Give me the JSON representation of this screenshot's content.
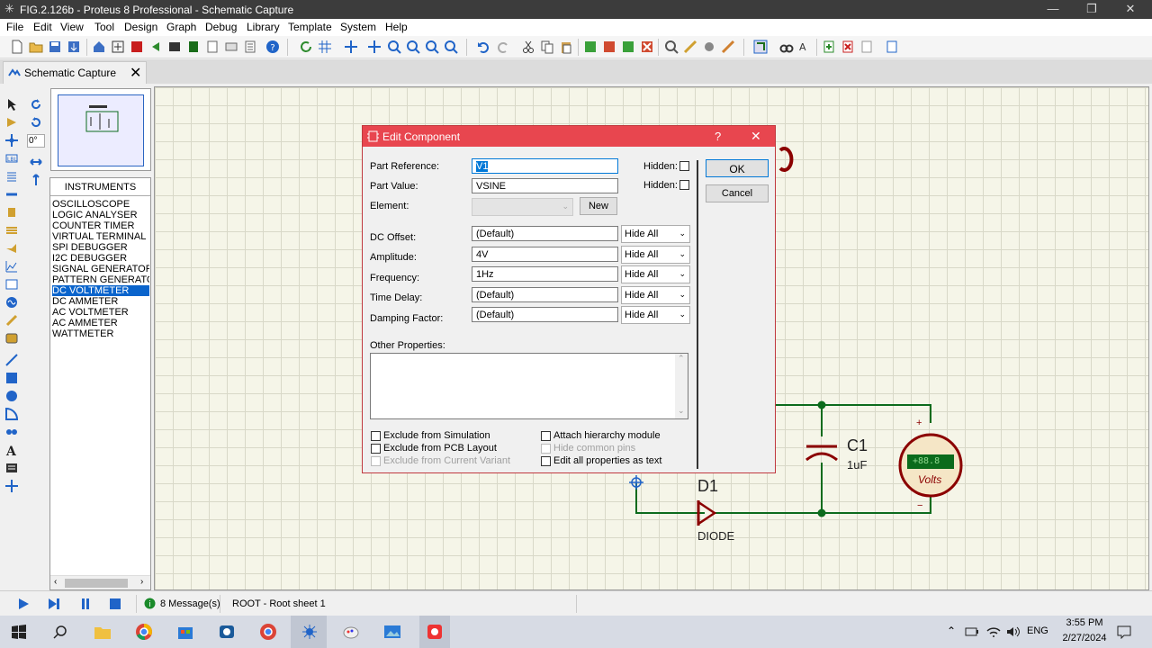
{
  "window": {
    "title": "FIG.2.126b - Proteus 8 Professional - Schematic Capture"
  },
  "menu": [
    "File",
    "Edit",
    "View",
    "Tool",
    "Design",
    "Graph",
    "Debug",
    "Library",
    "Template",
    "System",
    "Help"
  ],
  "tab": {
    "label": "Schematic Capture"
  },
  "rotation": "0°",
  "library": {
    "header": "INSTRUMENTS",
    "items": [
      "OSCILLOSCOPE",
      "LOGIC ANALYSER",
      "COUNTER TIMER",
      "VIRTUAL TERMINAL",
      "SPI DEBUGGER",
      "I2C DEBUGGER",
      "SIGNAL GENERATOR",
      "PATTERN GENERATO",
      "DC VOLTMETER",
      "DC AMMETER",
      "AC VOLTMETER",
      "AC AMMETER",
      "WATTMETER"
    ],
    "selected": "DC VOLTMETER"
  },
  "dialog": {
    "title": "Edit Component",
    "help": "?",
    "part_reference": {
      "label": "Part Reference:",
      "value": "V1"
    },
    "part_value": {
      "label": "Part Value:",
      "value": "VSINE"
    },
    "element": {
      "label": "Element:",
      "value": ""
    },
    "hidden_label": "Hidden:",
    "new_button": "New",
    "ok_button": "OK",
    "cancel_button": "Cancel",
    "properties": [
      {
        "label": "DC Offset:",
        "value": "(Default)",
        "visibility": "Hide All"
      },
      {
        "label": "Amplitude:",
        "value": "4V",
        "visibility": "Hide All"
      },
      {
        "label": "Frequency:",
        "value": "1Hz",
        "visibility": "Hide All"
      },
      {
        "label": "Time Delay:",
        "value": "(Default)",
        "visibility": "Hide All"
      },
      {
        "label": "Damping Factor:",
        "value": "(Default)",
        "visibility": "Hide All"
      }
    ],
    "other_properties_label": "Other Properties:",
    "checkboxes": {
      "exclude_simulation": "Exclude from Simulation",
      "exclude_pcb": "Exclude from PCB Layout",
      "exclude_variant": "Exclude from Current Variant",
      "attach_hierarchy": "Attach hierarchy module",
      "hide_common_pins": "Hide common pins",
      "edit_all_text": "Edit all properties as text"
    }
  },
  "schematic": {
    "c1_ref": "C1",
    "c1_value": "1uF",
    "d1_ref": "D1",
    "d1_value": "DIODE",
    "meter_text": "Volts",
    "meter_display": "+88.8",
    "plus": "+",
    "minus": "−"
  },
  "status": {
    "messages": "8 Message(s)",
    "sheet": "ROOT - Root sheet 1"
  },
  "taskbar": {
    "lang": "ENG",
    "time": "3:55 PM",
    "date": "2/27/2024"
  },
  "colors": {
    "dialog_title": "#e8464f",
    "wire": "#0b6b1c",
    "component": "#8b0000",
    "selection": "#0a64cc"
  }
}
